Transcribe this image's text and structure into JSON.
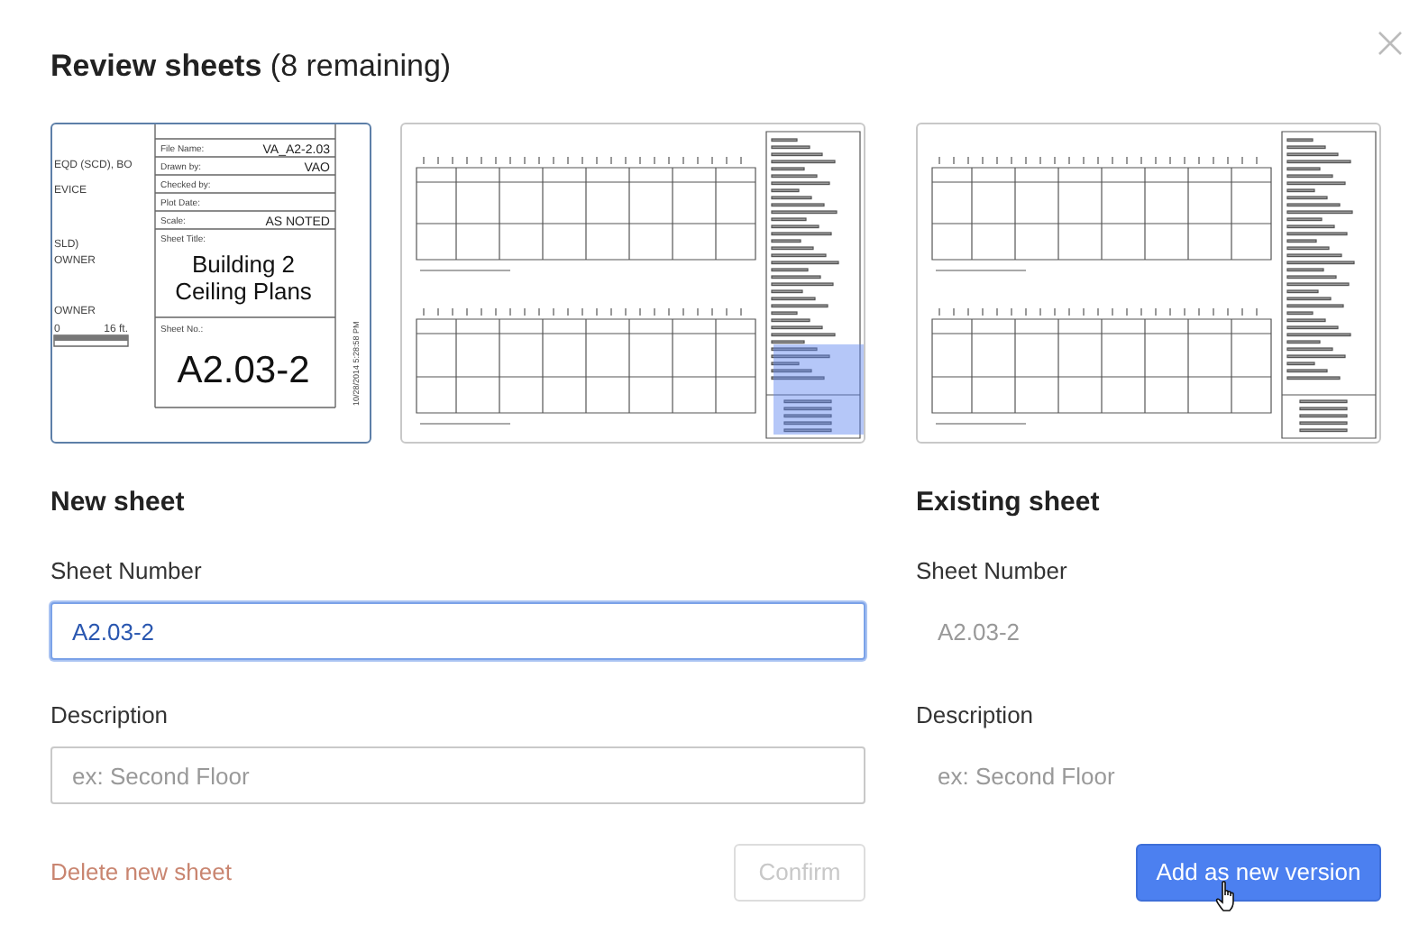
{
  "dialog": {
    "title": "Review sheets",
    "subtitle": "(8 remaining)"
  },
  "thumbnails": [
    {
      "kind": "title-block",
      "selected": true,
      "title_block": {
        "rows": [
          {
            "label": "File Name:",
            "value": "VA_A2-2.03"
          },
          {
            "label": "Drawn by:",
            "value": "VAO"
          },
          {
            "label": "Checked by:"
          },
          {
            "label": "Plot Date:"
          },
          {
            "label": "Scale:",
            "value": "AS NOTED"
          }
        ],
        "sheet_title_label": "Sheet Title:",
        "sheet_title": [
          "Building 2",
          "Ceiling Plans"
        ],
        "sheet_no_label": "Sheet No.:",
        "sheet_no": "A2.03-2",
        "plot_stamp": "10/28/2014 5:28:58 PM",
        "notes": [
          "EQD (SCD), BO",
          "EVICE",
          "SLD)",
          "OWNER",
          "OWNER"
        ],
        "scale_bar": {
          "start": "0",
          "end": "16 ft."
        }
      }
    },
    {
      "kind": "sheet",
      "selected": false,
      "highlighted": true
    },
    {
      "kind": "sheet",
      "selected": false,
      "highlighted": false
    }
  ],
  "new_sheet": {
    "heading": "New sheet",
    "fields": [
      {
        "label": "Sheet Number",
        "value": "A2.03-2",
        "focused": true,
        "disabled": false
      },
      {
        "label": "Description",
        "placeholder": "ex: Second Floor",
        "focused": false,
        "disabled": false
      }
    ]
  },
  "existing_sheet": {
    "heading": "Existing sheet",
    "fields": [
      {
        "label": "Sheet Number",
        "value": "A2.03-2",
        "focused": false,
        "disabled": true
      },
      {
        "label": "Description",
        "placeholder": "ex: Second Floor",
        "focused": false,
        "disabled": true
      }
    ]
  },
  "footer": {
    "delete_link": "Delete new sheet",
    "buttons": [
      {
        "label": "Confirm",
        "kind": "secondary",
        "disabled": true
      },
      {
        "label": "Add as new version",
        "kind": "primary",
        "disabled": false
      }
    ]
  }
}
